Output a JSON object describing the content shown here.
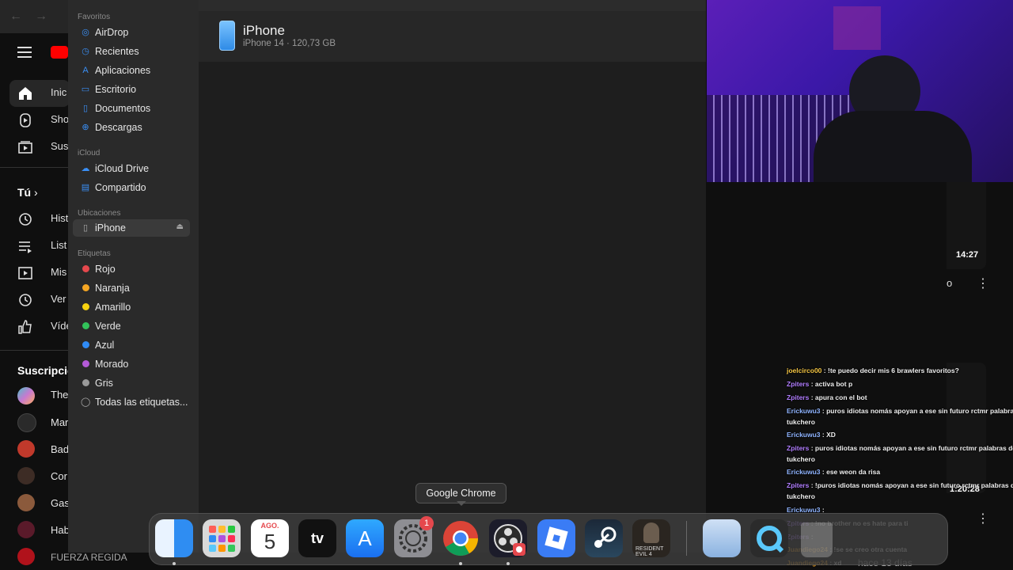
{
  "youtube": {
    "nav_items": [
      {
        "label": "Inic",
        "icon": "home-icon"
      },
      {
        "label": "Sho",
        "icon": "shorts-icon"
      },
      {
        "label": "Sus",
        "icon": "subscriptions-icon"
      }
    ],
    "you_section": "Tú",
    "library_items": [
      {
        "label": "Hist",
        "icon": "history-icon"
      },
      {
        "label": "List",
        "icon": "playlist-icon"
      },
      {
        "label": "Mis",
        "icon": "video-icon"
      },
      {
        "label": "Ver",
        "icon": "clock-icon"
      },
      {
        "label": "Víde",
        "icon": "thumbs-up-icon"
      }
    ],
    "subscriptions_title": "Suscripcio",
    "subscriptions": [
      "The",
      "Mar",
      "Bad",
      "Cor",
      "Gas",
      "Hab",
      "FUERZA REGIDA"
    ],
    "video_duration_1": "14:27",
    "video_duration_2": "1:20:28",
    "video_age": "hace 13 días"
  },
  "finder": {
    "sections": {
      "favoritos": "Favoritos",
      "icloud": "iCloud",
      "ubicaciones": "Ubicaciones",
      "etiquetas": "Etiquetas"
    },
    "favoritos": [
      {
        "label": "AirDrop",
        "icon": "airdrop-icon"
      },
      {
        "label": "Recientes",
        "icon": "clock-icon"
      },
      {
        "label": "Aplicaciones",
        "icon": "applications-icon"
      },
      {
        "label": "Escritorio",
        "icon": "desktop-icon"
      },
      {
        "label": "Documentos",
        "icon": "document-icon"
      },
      {
        "label": "Descargas",
        "icon": "download-icon"
      }
    ],
    "icloud": [
      {
        "label": "iCloud Drive",
        "icon": "cloud-icon"
      },
      {
        "label": "Compartido",
        "icon": "shared-folder-icon"
      }
    ],
    "ubicaciones": [
      {
        "label": "iPhone",
        "icon": "phone-icon"
      }
    ],
    "etiquetas": [
      {
        "label": "Rojo",
        "color": "#e5484d"
      },
      {
        "label": "Naranja",
        "color": "#f5a623"
      },
      {
        "label": "Amarillo",
        "color": "#f8d20f"
      },
      {
        "label": "Verde",
        "color": "#32c25a"
      },
      {
        "label": "Azul",
        "color": "#2f8bf5"
      },
      {
        "label": "Morado",
        "color": "#b45ad8"
      },
      {
        "label": "Gris",
        "color": "#9a9a9a"
      }
    ],
    "all_tags": "Todas las etiquetas...",
    "device": {
      "name": "iPhone",
      "details": "iPhone 14 · 120,73 GB"
    }
  },
  "chat": [
    {
      "user": "joelcirco00",
      "user_color": "#f4c542",
      "text": "!te puedo decir mis 6 brawlers favoritos?"
    },
    {
      "user": "Zpiters",
      "user_color": "#b07cff",
      "text": "activa bot p"
    },
    {
      "user": "Zpiters",
      "user_color": "#b07cff",
      "text": "apura con el bot"
    },
    {
      "user": "Erickuwu3",
      "user_color": "#8fb4ff",
      "text": "puros idiotas nomás apoyan a ese sin futuro rctmr palabras de"
    },
    {
      "user": "",
      "user_color": "#eee",
      "text": "tukchero"
    },
    {
      "user": "Erickuwu3",
      "user_color": "#8fb4ff",
      "text": "XD"
    },
    {
      "user": "Zpiters",
      "user_color": "#b07cff",
      "text": "puros idiotas nomás apoyan a ese sin futuro rctmr palabras de"
    },
    {
      "user": "",
      "user_color": "#eee",
      "text": "tukchero"
    },
    {
      "user": "Erickuwu3",
      "user_color": "#8fb4ff",
      "text": "ese weon da risa"
    },
    {
      "user": "Zpiters",
      "user_color": "#b07cff",
      "text": "!puros idiotas nomás apoyan a ese sin futuro rctmr palabras de"
    },
    {
      "user": "",
      "user_color": "#eee",
      "text": "tukchero"
    },
    {
      "user": "Erickuwu3",
      "user_color": "#8fb4ff",
      "text": ""
    },
    {
      "user": "Zpiters",
      "user_color": "#b07cff",
      "text": "!no brother no es hate para ti"
    },
    {
      "user": "Zpiters",
      "user_color": "#b07cff",
      "text": ""
    },
    {
      "user": "Juandiego24",
      "user_color": "#f5a623",
      "text": "!se se creo otra cuenta"
    },
    {
      "user": "Juandiego24",
      "user_color": "#f5a623",
      "text": "xd"
    }
  ],
  "dock": {
    "tooltip": "Google Chrome",
    "calendar_month": "AGO.",
    "calendar_day": "5",
    "settings_badge": "1",
    "apps": [
      "finder-icon",
      "launchpad-icon",
      "calendar-icon",
      "apple-tv-icon",
      "app-store-icon",
      "system-settings-icon",
      "chrome-icon",
      "obs-icon",
      "roblox-icon",
      "steam-icon",
      "resident-evil-icon",
      "preview-icon",
      "quicktime-icon",
      "trash-icon"
    ]
  }
}
